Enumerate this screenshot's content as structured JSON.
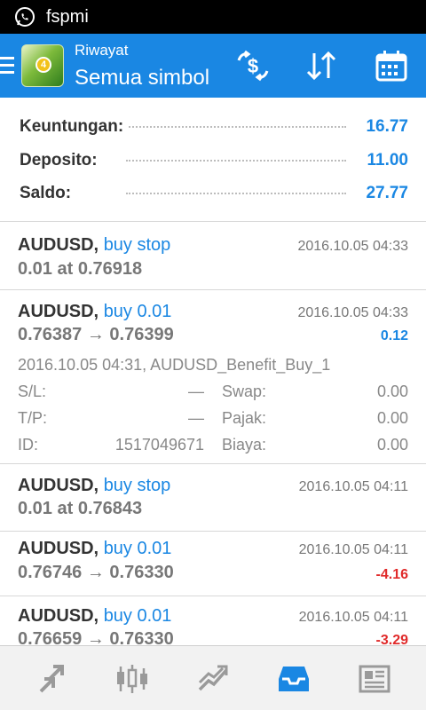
{
  "status_bar": {
    "notification": "fspmi"
  },
  "app_bar": {
    "subtitle": "Riwayat",
    "title": "Semua simbol",
    "logo_badge": "4",
    "accent": "#1a87e3"
  },
  "summary": [
    {
      "label": "Keuntungan:",
      "value": "16.77"
    },
    {
      "label": "Deposito:",
      "value": "11.00"
    },
    {
      "label": "Saldo:",
      "value": "27.77"
    }
  ],
  "trades": [
    {
      "symbol": "AUDUSD,",
      "action": "buy stop",
      "date": "2016.10.05 04:33",
      "line2": "0.01 at 0.76918"
    },
    {
      "symbol": "AUDUSD,",
      "action": "buy 0.01",
      "date": "2016.10.05 04:33",
      "open": "0.76387",
      "arrow": "→",
      "close": "0.76399",
      "profit": "0.12",
      "details": {
        "comment": "2016.10.05 04:31, AUDUSD_Benefit_Buy_1",
        "rows": [
          {
            "k1": "S/L:",
            "v1": "—",
            "k2": "Swap:",
            "v2": "0.00"
          },
          {
            "k1": "T/P:",
            "v1": "—",
            "k2": "Pajak:",
            "v2": "0.00"
          },
          {
            "k1": "ID:",
            "v1": "1517049671",
            "k2": "Biaya:",
            "v2": "0.00"
          }
        ]
      }
    },
    {
      "symbol": "AUDUSD,",
      "action": "buy stop",
      "date": "2016.10.05 04:11",
      "line2": "0.01 at 0.76843"
    },
    {
      "symbol": "AUDUSD,",
      "action": "buy 0.01",
      "date": "2016.10.05 04:11",
      "open": "0.76746",
      "arrow": "→",
      "close": "0.76330",
      "profit": "-4.16"
    },
    {
      "symbol": "AUDUSD,",
      "action": "buy 0.01",
      "date": "2016.10.05 04:11",
      "open": "0.76659",
      "arrow": "→",
      "close": "0.76330",
      "profit": "-3.29"
    }
  ],
  "bottom_nav": [
    {
      "icon": "quotes-arrows-icon",
      "active": false
    },
    {
      "icon": "candlestick-chart-icon",
      "active": false
    },
    {
      "icon": "trade-chart-icon",
      "active": false
    },
    {
      "icon": "history-inbox-icon",
      "active": true
    },
    {
      "icon": "news-icon",
      "active": false
    }
  ],
  "colors": {
    "positive": "#1a87e3",
    "negative": "#e02a2a",
    "inactive_icon": "#9a9a9a"
  }
}
